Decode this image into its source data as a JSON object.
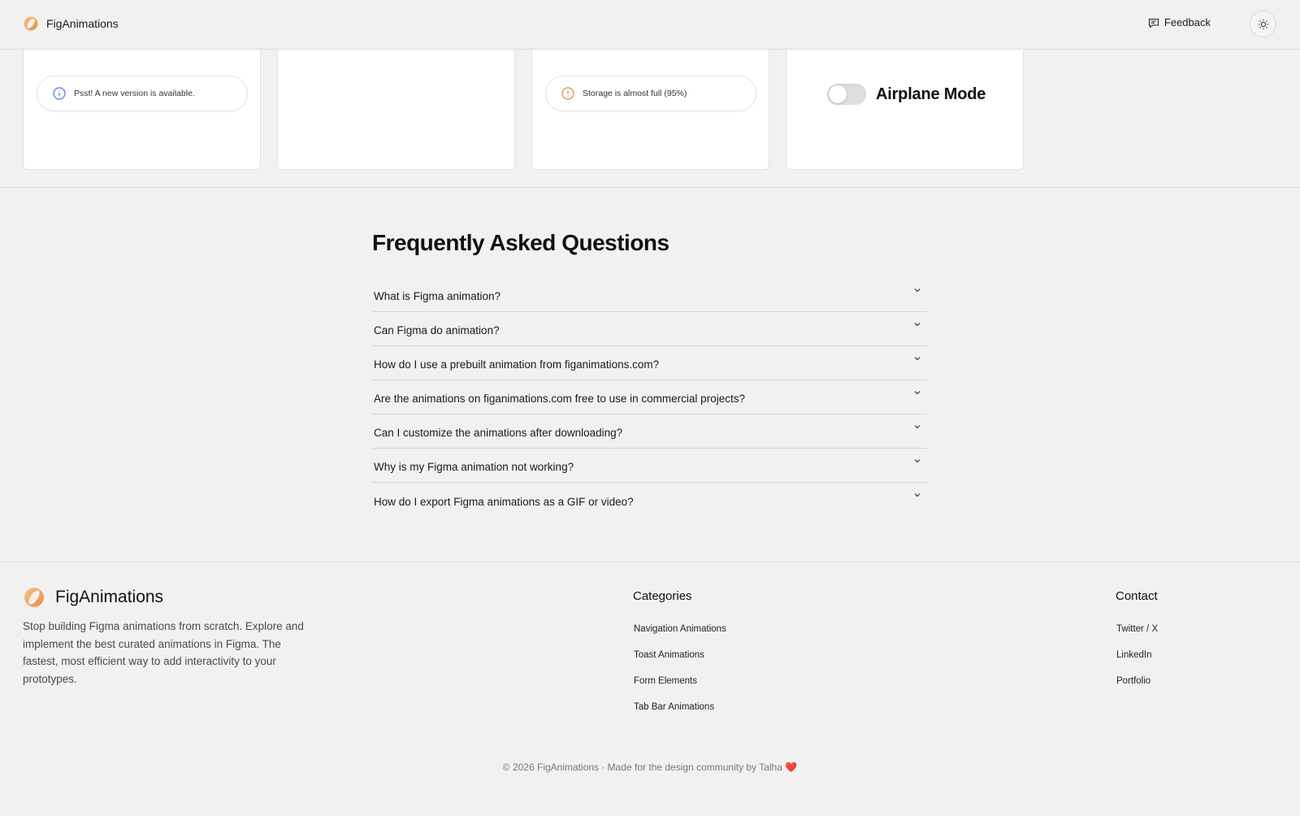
{
  "header": {
    "brand_name": "FigAnimations",
    "feedback_label": "Feedback"
  },
  "cards": {
    "toast_info_text": "Psst! A new version is available.",
    "toast_warning_text": "Storage is almost full (95%)",
    "airplane_label": "Airplane Mode",
    "airplane_on": false
  },
  "faq": {
    "title": "Frequently Asked Questions",
    "questions": [
      "What is Figma animation?",
      "Can Figma do animation?",
      "How do I use a prebuilt animation from figanimations.com?",
      "Are the animations on figanimations.com free to use in commercial projects?",
      "Can I customize the animations after downloading?",
      "Why is my Figma animation not working?",
      "How do I export Figma animations as a GIF or video?"
    ]
  },
  "footer": {
    "brand_name": "FigAnimations",
    "description": "Stop building Figma animations from scratch. Explore and implement the best curated animations in Figma. The fastest, most efficient way to add interactivity to your prototypes.",
    "categories_title": "Categories",
    "categories": [
      "Navigation Animations",
      "Toast Animations",
      "Form Elements",
      "Tab Bar Animations"
    ],
    "contact_title": "Contact",
    "contact": [
      "Twitter / X",
      "LinkedIn",
      "Portfolio"
    ],
    "copyright": "© 2026 FigAnimations · Made for the design community by Talha",
    "heart": "❤️"
  },
  "colors": {
    "background": "#f1f1ef",
    "info_icon": "#4a7bd8",
    "warning_icon": "#e08a3c",
    "logo_orange": "#f0a25c"
  },
  "icons": {
    "brand": "orange-ring-logo",
    "feedback": "message-square-icon",
    "theme": "sun-icon",
    "info": "info-circle-icon",
    "warning": "alert-circle-icon",
    "faq": "chevron-down-icon"
  }
}
